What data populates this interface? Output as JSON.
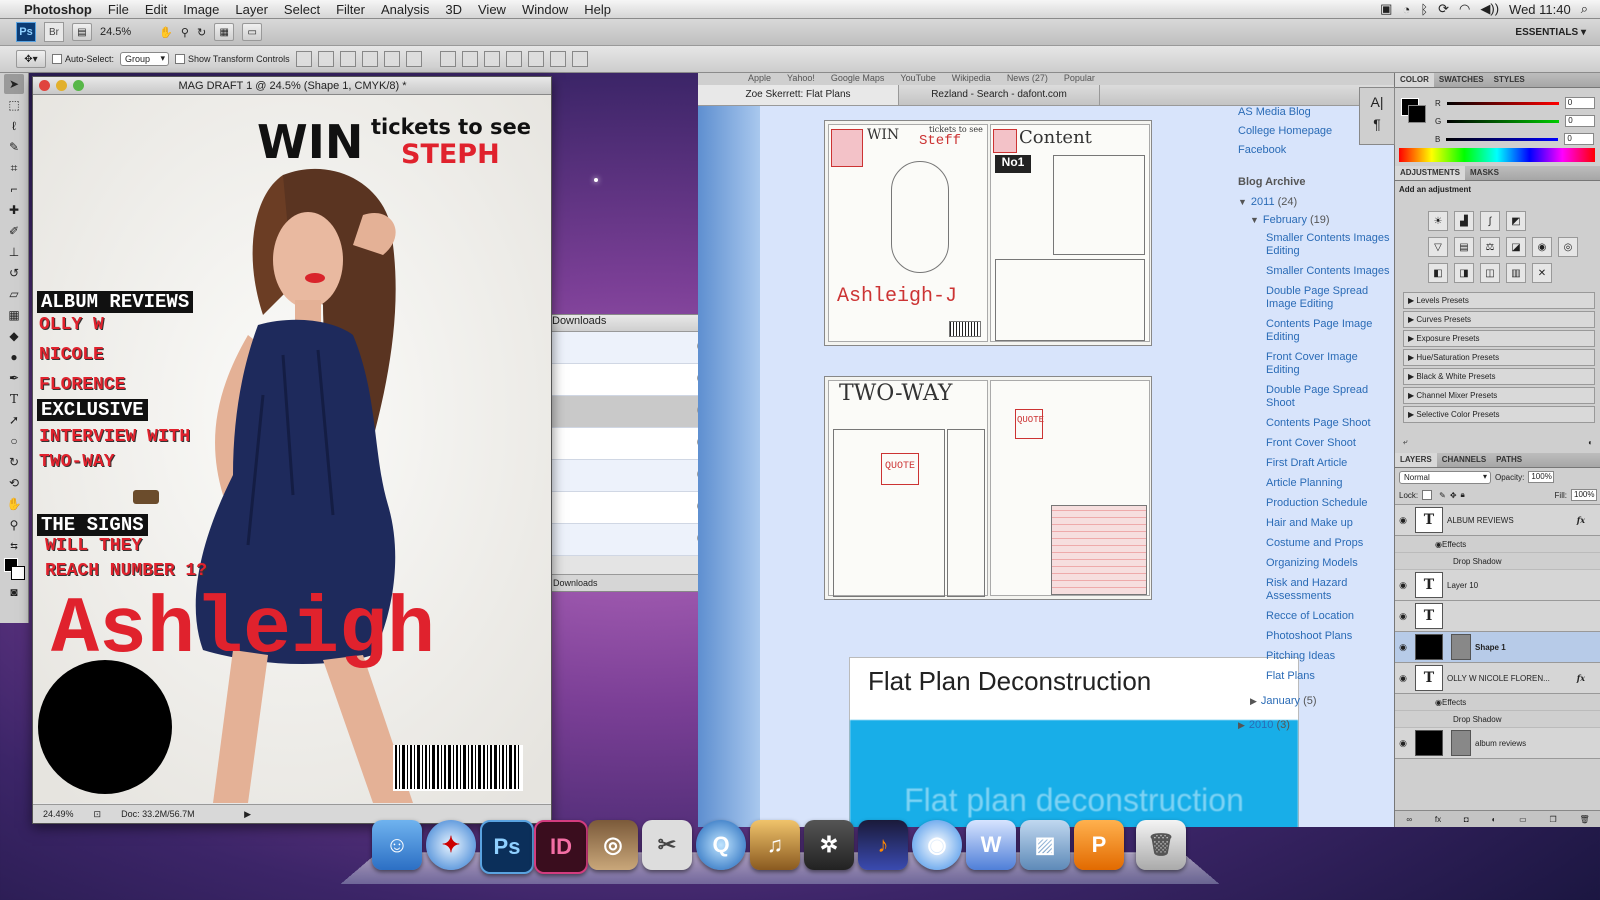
{
  "menubar": {
    "app": "Photoshop",
    "items": [
      "File",
      "Edit",
      "Image",
      "Layer",
      "Select",
      "Filter",
      "Analysis",
      "3D",
      "View",
      "Window",
      "Help"
    ],
    "clock": "Wed 11:40"
  },
  "appbar": {
    "ps": "Ps",
    "br": "Br",
    "zoom": "24.5%",
    "workspace": "ESSENTIALS ▾"
  },
  "options": {
    "auto_select": "Auto-Select:",
    "group": "Group",
    "show_transform": "Show Transform Controls"
  },
  "document": {
    "title": "MAG DRAFT 1 @ 24.5% (Shape 1, CMYK/8) *",
    "zoom_status": "24.49%",
    "doc_size": "Doc: 33.2M/56.7M",
    "win": "WIN",
    "tickets": "tickets to see",
    "steph": "STEPH",
    "album_reviews": "ALBUM REVIEWS",
    "olly": "OLLY W",
    "nicole": "NICOLE",
    "florence": "FLORENCE",
    "exclusive": "EXCLUSIVE",
    "interview": "INTERVIEW WITH",
    "twoway": "TWO-WAY",
    "the_signs": "THE SIGNS",
    "will_they": "WILL THEY",
    "reach": "REACH NUMBER 1?",
    "ashleigh": "Ashleigh"
  },
  "downloads": {
    "title": "Downloads",
    "footer": "Downloads"
  },
  "browser": {
    "bookmarks": [
      "Apple",
      "Yahoo!",
      "Google Maps",
      "YouTube",
      "Wikipedia",
      "News (27)",
      "Popular"
    ],
    "tabs": [
      "Zoe Skerrett: Flat Plans",
      "Rezland - Search - dafont.com"
    ],
    "post_title": "Flat Plan Deconstruction",
    "video_text": "Flat plan deconstruction",
    "sketch": {
      "win": "WIN",
      "tickets": "tickets to see",
      "steff": "Steff",
      "content": "Content",
      "no1": "No1",
      "ashleigh": "Ashleigh-J",
      "twoway": "TWO-WAY",
      "quote": "QUOTE",
      "quote2": "QUOTE"
    },
    "sidebar_links": [
      "AS Media Blog",
      "College Homepage",
      "Facebook"
    ],
    "archive_heading": "Blog Archive",
    "year_2011": "2011",
    "year_2011_count": "(24)",
    "february": "February",
    "february_count": "(19)",
    "posts": [
      "Smaller Contents Images Editing",
      "Smaller Contents Images",
      "Double Page Spread Image Editing",
      "Contents Page Image Editing",
      "Front Cover Image Editing",
      "Double Page Spread Shoot",
      "Contents Page Shoot",
      "Front Cover Shoot",
      "First Draft Article",
      "Article Planning",
      "Production Schedule",
      "Hair and Make up",
      "Costume and Props",
      "Organizing Models",
      "Risk and Hazard Assessments",
      "Recce of Location",
      "Photoshoot Plans",
      "Pitching Ideas",
      "Flat Plans"
    ],
    "january": "January",
    "january_count": "(5)",
    "year_2010": "2010",
    "year_2010_count": "(3)"
  },
  "panels": {
    "color_tabs": [
      "COLOR",
      "SWATCHES",
      "STYLES"
    ],
    "rgb": [
      {
        "ch": "R",
        "val": "0"
      },
      {
        "ch": "G",
        "val": "0"
      },
      {
        "ch": "B",
        "val": "0"
      }
    ],
    "adj_tabs": [
      "ADJUSTMENTS",
      "MASKS"
    ],
    "add_adjustment": "Add an adjustment",
    "presets": [
      "Levels Presets",
      "Curves Presets",
      "Exposure Presets",
      "Hue/Saturation Presets",
      "Black & White Presets",
      "Channel Mixer Presets",
      "Selective Color Presets"
    ],
    "layer_tabs": [
      "LAYERS",
      "CHANNELS",
      "PATHS"
    ],
    "blend": "Normal",
    "opacity_label": "Opacity:",
    "opacity": "100%",
    "lock_label": "Lock:",
    "fill_label": "Fill:",
    "fill": "100%",
    "layers": [
      {
        "name": "ALBUM REVIEWS",
        "type": "text",
        "fx": true
      },
      {
        "name": "Effects",
        "type": "effects"
      },
      {
        "name": "Drop Shadow",
        "type": "effect"
      },
      {
        "name": "Layer 10",
        "type": "text"
      },
      {
        "name": "",
        "type": "text"
      },
      {
        "name": "Shape 1",
        "type": "shape",
        "selected": true
      },
      {
        "name": "OLLY W NICOLE FLOREN...",
        "type": "text",
        "fx": true
      },
      {
        "name": "Effects",
        "type": "effects"
      },
      {
        "name": "Drop Shadow",
        "type": "effect"
      },
      {
        "name": "album reviews",
        "type": "shape"
      }
    ]
  }
}
